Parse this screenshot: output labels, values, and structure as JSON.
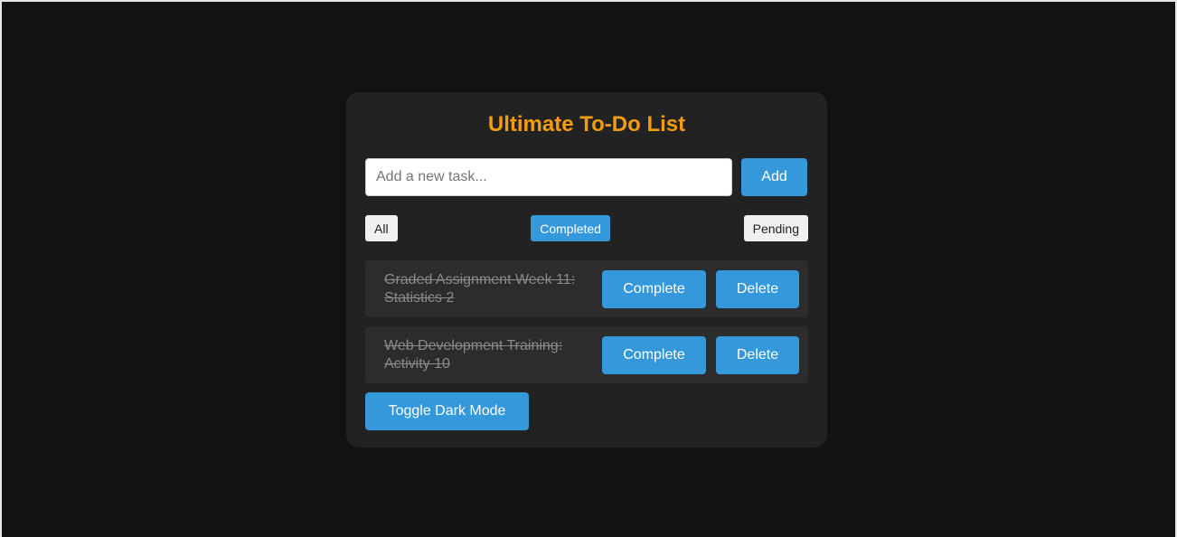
{
  "app": {
    "title": "Ultimate To-Do List"
  },
  "input": {
    "placeholder": "Add a new task...",
    "value": "",
    "add_label": "Add"
  },
  "filters": [
    {
      "label": "All",
      "active": false
    },
    {
      "label": "Completed",
      "active": true
    },
    {
      "label": "Pending",
      "active": false
    }
  ],
  "tasks": [
    {
      "line1": "Graded Assignment Week 11:",
      "line2": "Statistics 2",
      "completed": true,
      "complete_label": "Complete",
      "delete_label": "Delete"
    },
    {
      "line1": "Web Development Training:",
      "line2": "Activity 10",
      "completed": true,
      "complete_label": "Complete",
      "delete_label": "Delete"
    }
  ],
  "footer": {
    "toggle_label": "Toggle Dark Mode"
  },
  "colors": {
    "background": "#121212",
    "card": "#222222",
    "accent": "#3498db",
    "title": "#f39c12",
    "task_bg": "#2c2c2c",
    "task_text": "#8a8a8a"
  }
}
